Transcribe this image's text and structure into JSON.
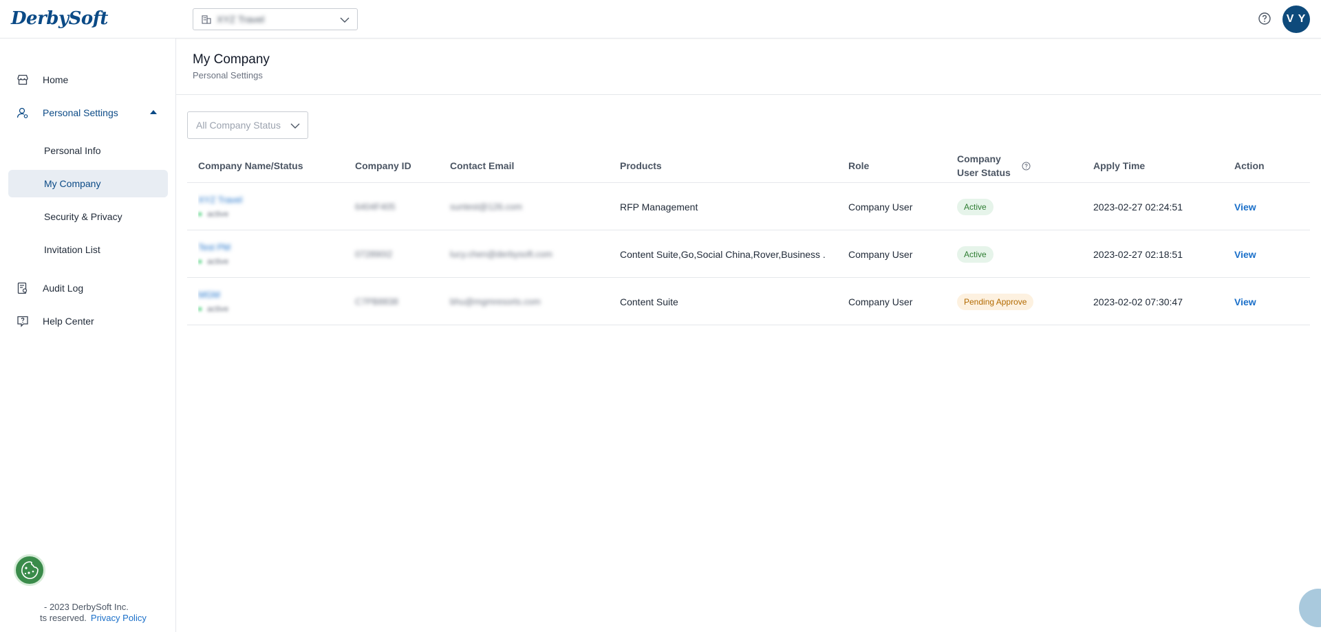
{
  "header": {
    "logo": "DerbySoft",
    "company_select_value": "XYZ Travel",
    "avatar_initials": "V Y"
  },
  "sidebar": {
    "home": "Home",
    "personal_settings": "Personal Settings",
    "sub_items": [
      "Personal Info",
      "My Company",
      "Security & Privacy",
      "Invitation List"
    ],
    "audit_log": "Audit Log",
    "help_center": "Help Center",
    "footer_line1": "- 2023 DerbySoft Inc.",
    "footer_line2": "ts reserved.",
    "privacy_policy": "Privacy Policy"
  },
  "page": {
    "title": "My Company",
    "subtitle": "Personal Settings",
    "status_filter_placeholder": "All Company Status"
  },
  "table": {
    "headers": {
      "name_status": "Company Name/Status",
      "company_id": "Company ID",
      "contact_email": "Contact Email",
      "products": "Products",
      "role": "Role",
      "user_status_line1": "Company",
      "user_status_line2": "User Status",
      "apply_time": "Apply Time",
      "action": "Action"
    },
    "rows": [
      {
        "name": "XYZ Travel",
        "status": "active",
        "company_id": "6404F405",
        "email": "suntest@126.com",
        "products": "RFP Management",
        "role": "Company User",
        "user_status": "Active",
        "apply_time": "2023-02-27 02:24:51",
        "action": "View"
      },
      {
        "name": "Test PM",
        "status": "active",
        "company_id": "072890I2",
        "email": "lucy.chen@derbysoft.com",
        "products": "Content Suite,Go,Social China,Rover,Business ...",
        "role": "Company User",
        "user_status": "Active",
        "apply_time": "2023-02-27 02:18:51",
        "action": "View"
      },
      {
        "name": "MGM",
        "status": "active",
        "company_id": "C7PB8838",
        "email": "bhu@mgmresorts.com",
        "products": "Content Suite",
        "role": "Company User",
        "user_status": "Pending Approve",
        "apply_time": "2023-02-02 07:30:47",
        "action": "View"
      }
    ]
  },
  "colors": {
    "brand": "#0b4a86",
    "link": "#1a6fc9",
    "active_badge_bg": "#e6f4ea",
    "pending_badge_bg": "#fdf1e0"
  }
}
